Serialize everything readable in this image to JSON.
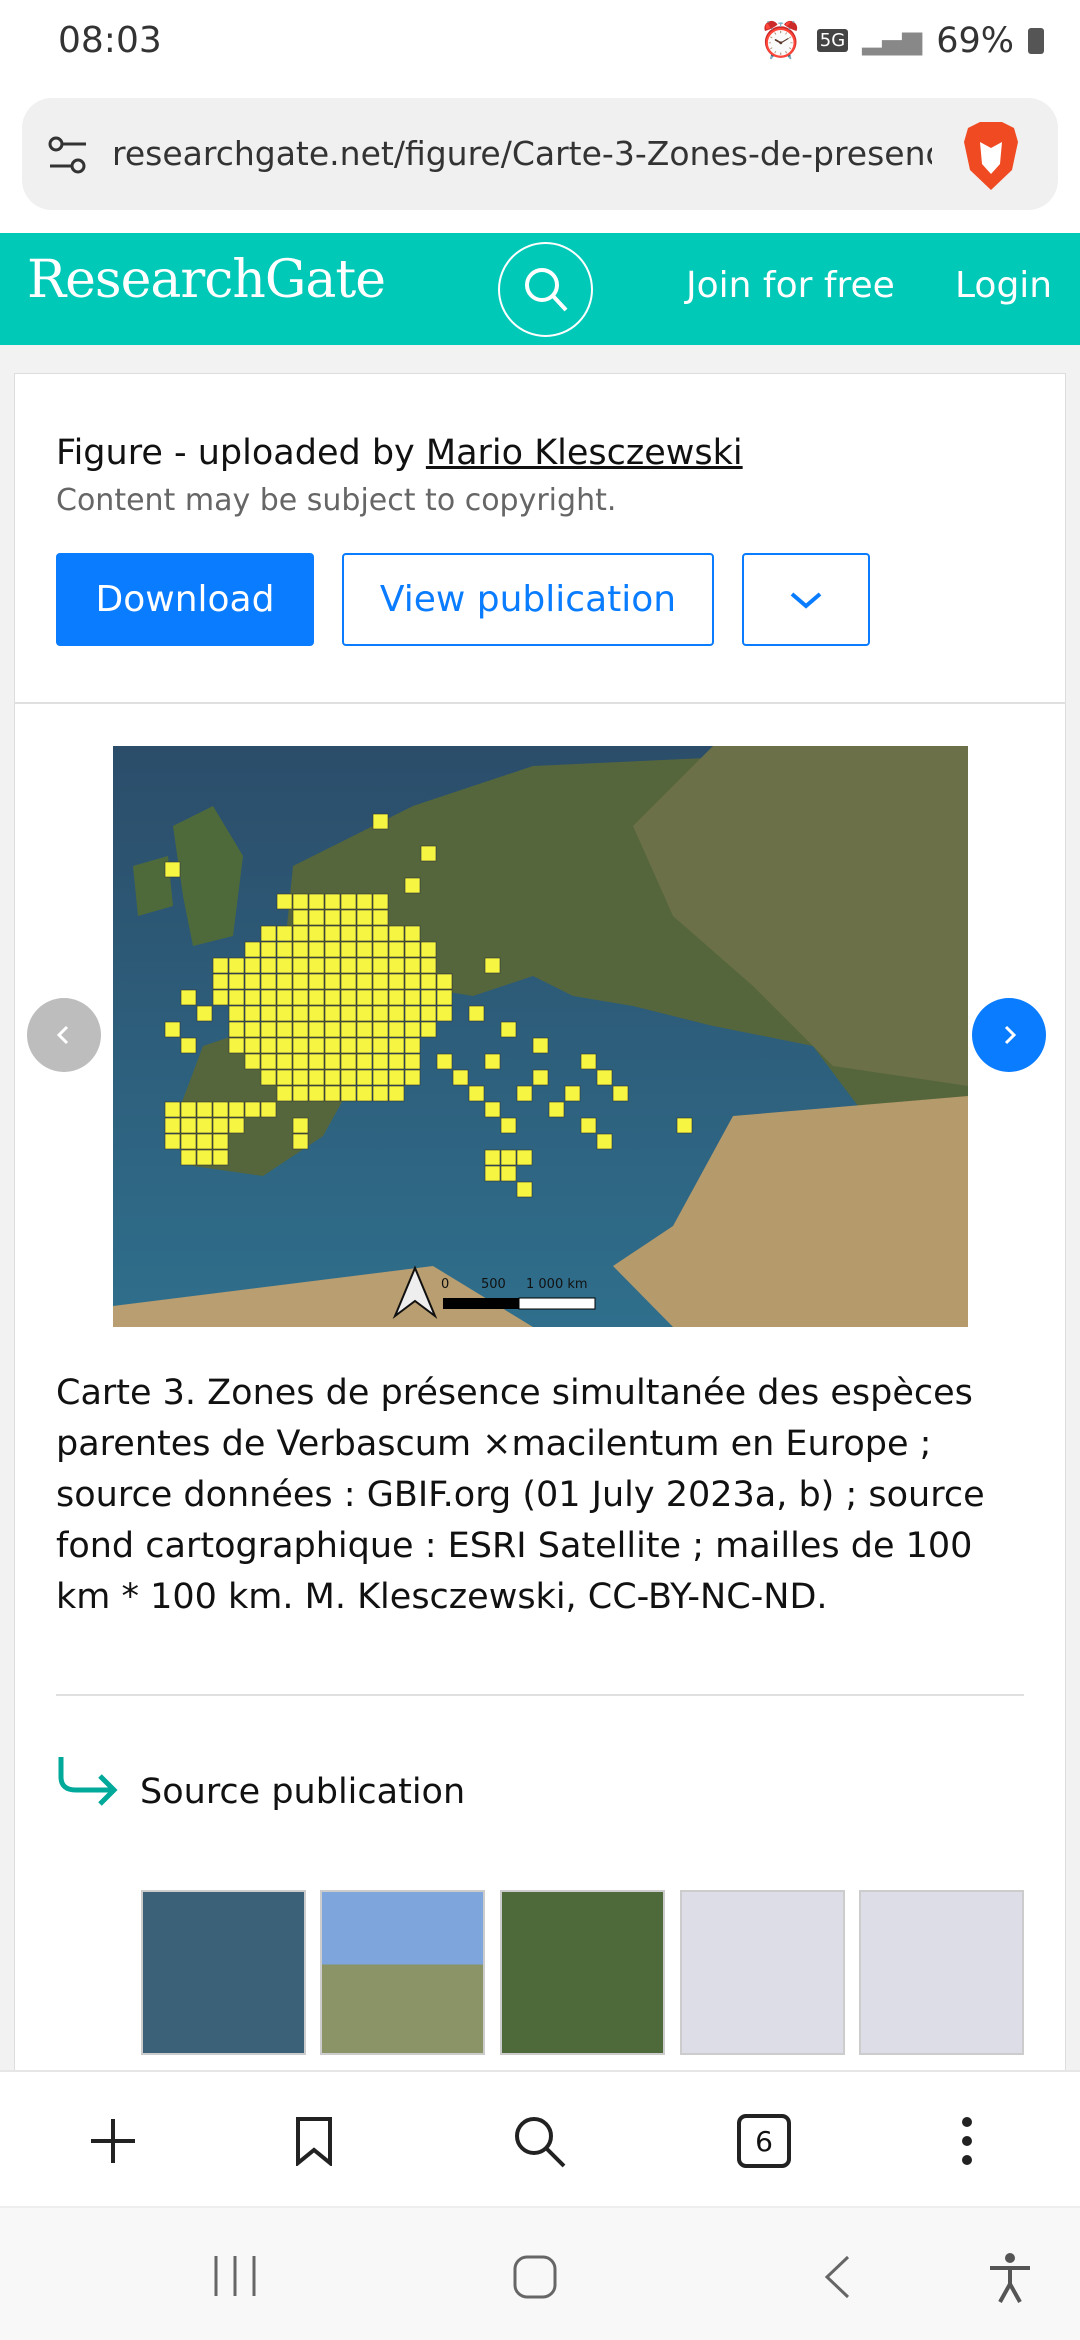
{
  "status": {
    "time": "08:03",
    "network": "5G",
    "battery": "69%"
  },
  "browser": {
    "url": "researchgate.net/figure/Carte-3-Zones-de-presence",
    "tab_count": "6"
  },
  "header": {
    "logo": "ResearchGate",
    "join": "Join for free",
    "login": "Login"
  },
  "figure": {
    "uploaded_prefix": "Figure - uploaded by ",
    "uploader": "Mario Klesczewski",
    "copyright": "Content may be subject to copyright.",
    "download": "Download",
    "view_publication": "View publication",
    "scale_labels": [
      "0",
      "500",
      "1 000 km"
    ],
    "caption": "Carte 3. Zones de présence simultanée des espèces parentes de Verbascum ×macilentum en Europe ; source données : GBIF.org (01 July 2023a, b) ; source fond cartographique : ESRI Satellite ; mailles de 100 km * 100 km. M. Klesczewski, CC-BY-NC-ND."
  },
  "source": {
    "label": "Source publication"
  },
  "colors": {
    "teal": "#00c9b8",
    "blue": "#0a7cff",
    "grid_yellow": "#f5f542"
  }
}
